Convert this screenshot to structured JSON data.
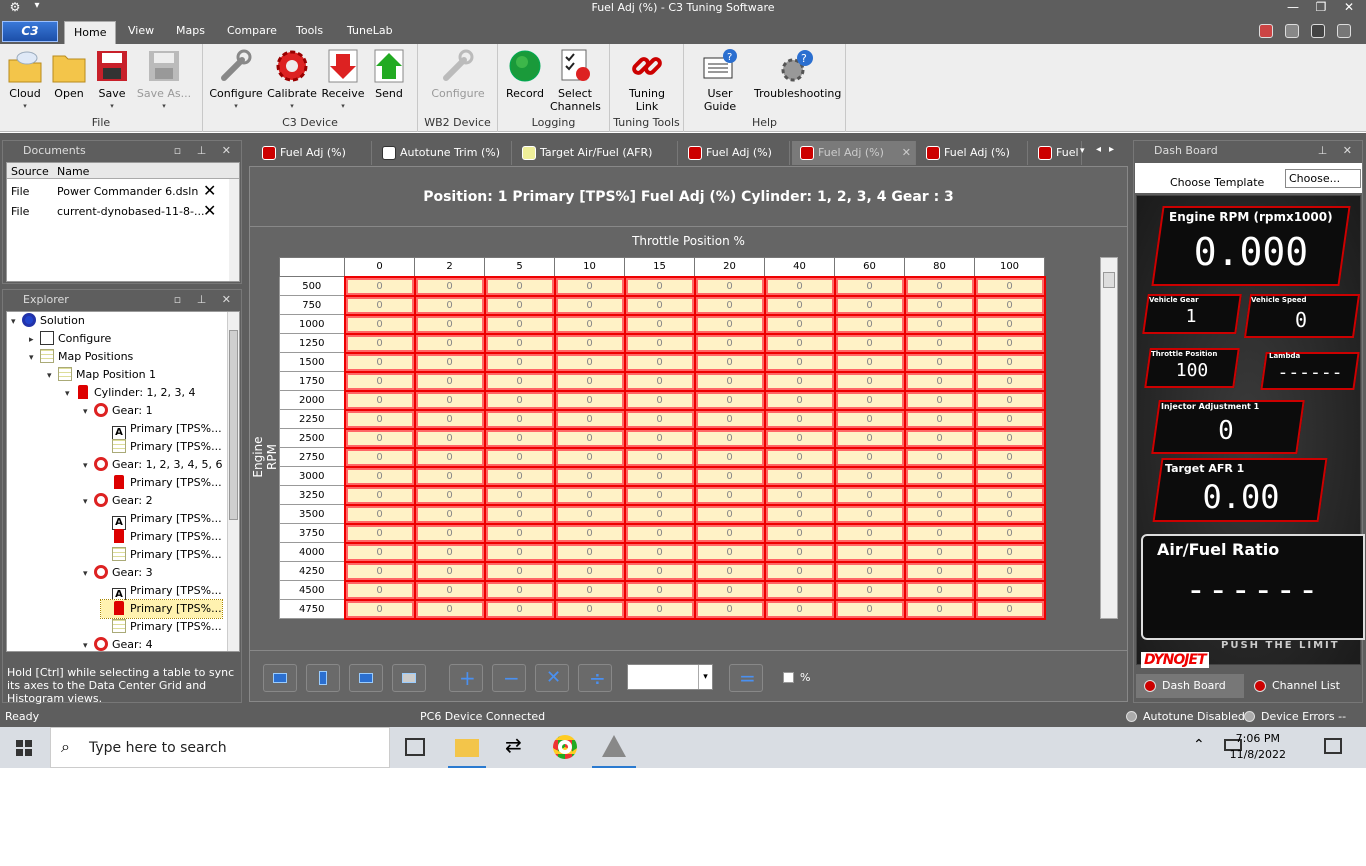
{
  "window": {
    "title": "Fuel Adj (%) - C3 Tuning Software",
    "app_logo": "C3"
  },
  "menu": [
    "Home",
    "View",
    "Maps",
    "Compare",
    "Tools",
    "TuneLab"
  ],
  "ribbon": {
    "groups": [
      {
        "label": "File",
        "buttons": [
          {
            "label": "Cloud",
            "icon": "cloud-folder-icon",
            "dropdown": true
          },
          {
            "label": "Open",
            "icon": "folder-icon"
          },
          {
            "label": "Save",
            "icon": "floppy-icon",
            "dropdown": true
          },
          {
            "label": "Save As...",
            "icon": "floppy-disabled-icon",
            "dropdown": true,
            "disabled": true
          }
        ]
      },
      {
        "label": "C3 Device",
        "buttons": [
          {
            "label": "Configure",
            "icon": "wrench-icon",
            "dropdown": true
          },
          {
            "label": "Calibrate",
            "icon": "gear-icon",
            "dropdown": true
          },
          {
            "label": "Receive",
            "icon": "down-arrow-icon",
            "dropdown": true
          },
          {
            "label": "Send",
            "icon": "up-arrow-icon"
          }
        ]
      },
      {
        "label": "WB2 Device",
        "buttons": [
          {
            "label": "Configure",
            "icon": "wrench-disabled-icon",
            "disabled": true
          }
        ]
      },
      {
        "label": "Logging",
        "buttons": [
          {
            "label": "Record",
            "icon": "record-icon"
          },
          {
            "label": "Select Channels",
            "icon": "checklist-icon"
          }
        ]
      },
      {
        "label": "Tuning Tools",
        "buttons": [
          {
            "label": "Tuning Link",
            "icon": "chain-link-icon"
          }
        ]
      },
      {
        "label": "Help",
        "buttons": [
          {
            "label": "User Guide",
            "icon": "book-help-icon"
          },
          {
            "label": "Troubleshooting",
            "icon": "gears-help-icon"
          }
        ]
      }
    ]
  },
  "documents": {
    "title": "Documents",
    "headers": [
      "Source",
      "Name"
    ],
    "rows": [
      {
        "source": "File",
        "name": "Power Commander 6.dsln"
      },
      {
        "source": "File",
        "name": "current-dynobased-11-8-..."
      }
    ]
  },
  "explorer": {
    "title": "Explorer",
    "nodes": [
      {
        "text": "Solution",
        "depth": 0,
        "icon": "solution",
        "glyph": "▾"
      },
      {
        "text": "Configure",
        "depth": 1,
        "icon": "wrench",
        "glyph": "▸"
      },
      {
        "text": "Map Positions",
        "depth": 1,
        "icon": "map",
        "glyph": "▾"
      },
      {
        "text": "Map Position  1",
        "depth": 2,
        "icon": "map",
        "glyph": "▾"
      },
      {
        "text": "Cylinder: 1, 2, 3, 4",
        "depth": 3,
        "icon": "piston",
        "glyph": "▾"
      },
      {
        "text": "Gear: 1",
        "depth": 4,
        "icon": "gear",
        "glyph": "▾"
      },
      {
        "text": "Primary  [TPS%...",
        "depth": 5,
        "icon": "A"
      },
      {
        "text": "Primary  [TPS%...",
        "depth": 5,
        "icon": "grid"
      },
      {
        "text": "Gear: 1, 2, 3, 4, 5, 6",
        "depth": 4,
        "icon": "gear",
        "glyph": "▾"
      },
      {
        "text": "Primary  [TPS%...",
        "depth": 5,
        "icon": "pc"
      },
      {
        "text": "Gear: 2",
        "depth": 4,
        "icon": "gear",
        "glyph": "▾"
      },
      {
        "text": "Primary  [TPS%...",
        "depth": 5,
        "icon": "A"
      },
      {
        "text": "Primary  [TPS%...",
        "depth": 5,
        "icon": "pc"
      },
      {
        "text": "Primary  [TPS%...",
        "depth": 5,
        "icon": "grid"
      },
      {
        "text": "Gear: 3",
        "depth": 4,
        "icon": "gear",
        "glyph": "▾"
      },
      {
        "text": "Primary  [TPS%...",
        "depth": 5,
        "icon": "A"
      },
      {
        "text": "Primary  [TPS%...",
        "depth": 5,
        "icon": "pc",
        "selected": true
      },
      {
        "text": "Primary  [TPS%...",
        "depth": 5,
        "icon": "grid"
      },
      {
        "text": "Gear: 4",
        "depth": 4,
        "icon": "gear",
        "glyph": "▾"
      }
    ],
    "hint": "Hold [Ctrl] while selecting a table to sync its axes to the Data Center Grid and Histogram views."
  },
  "doc_tabs": [
    {
      "label": "Fuel Adj (%)",
      "icon": "pc"
    },
    {
      "label": "Autotune Trim (%)",
      "icon": "A"
    },
    {
      "label": "Target Air/Fuel (AFR)",
      "icon": "grid"
    },
    {
      "label": "Fuel Adj (%)",
      "icon": "pc"
    },
    {
      "label": "Fuel Adj (%)",
      "icon": "pc",
      "active": true
    },
    {
      "label": "Fuel Adj (%)",
      "icon": "pc"
    },
    {
      "label": "Fuel",
      "icon": "pc"
    }
  ],
  "table": {
    "header": "Position: 1  Primary  [TPS%] Fuel Adj (%)  Cylinder: 1, 2, 3, 4  Gear : 3",
    "x_title": "Throttle Position %",
    "y_title": "Engine RPM",
    "columns": [
      "0",
      "2",
      "5",
      "10",
      "15",
      "20",
      "40",
      "60",
      "80",
      "100"
    ],
    "rows": [
      "500",
      "750",
      "1000",
      "1250",
      "1500",
      "1750",
      "2000",
      "2250",
      "2500",
      "2750",
      "3000",
      "3250",
      "3500",
      "3750",
      "4000",
      "4250",
      "4500",
      "4750"
    ],
    "cell_value": "0",
    "pct_label": "%"
  },
  "dashboard": {
    "title": "Dash Board",
    "template_label": "Choose Template",
    "template_value": "Choose...",
    "gauges": {
      "rpm": {
        "label": "Engine RPM  (rpmx1000)",
        "value": "0.000"
      },
      "gear": {
        "label": "Vehicle Gear",
        "value": "1"
      },
      "speed": {
        "label": "Vehicle Speed",
        "value": "0"
      },
      "tps": {
        "label": "Throttle Position",
        "value": "100"
      },
      "lambda": {
        "label": "Lambda",
        "value": "------"
      },
      "injector": {
        "label": "Injector Adjustment 1",
        "value": "0"
      },
      "afr_target": {
        "label": "Target AFR 1",
        "value": "0.00"
      },
      "afr": {
        "label": "Air/Fuel Ratio",
        "value": "------"
      }
    },
    "tagline": "PUSH THE LIMIT",
    "brand": "DYNOJET",
    "bottom_tabs": [
      "Dash Board",
      "Channel List"
    ]
  },
  "status": {
    "ready": "Ready",
    "device": "PC6 Device Connected",
    "autotune": "Autotune Disabled",
    "errors": "Device Errors --"
  },
  "taskbar": {
    "search_placeholder": "Type here to search",
    "time": "7:06 PM",
    "date": "11/8/2022"
  },
  "colors": {
    "chrome": "#5e5e5e",
    "ribbon": "#eeeeee",
    "cell_border": "#e00000",
    "cell_fill": "#fff2c6",
    "accent": "#2b6fd0"
  }
}
